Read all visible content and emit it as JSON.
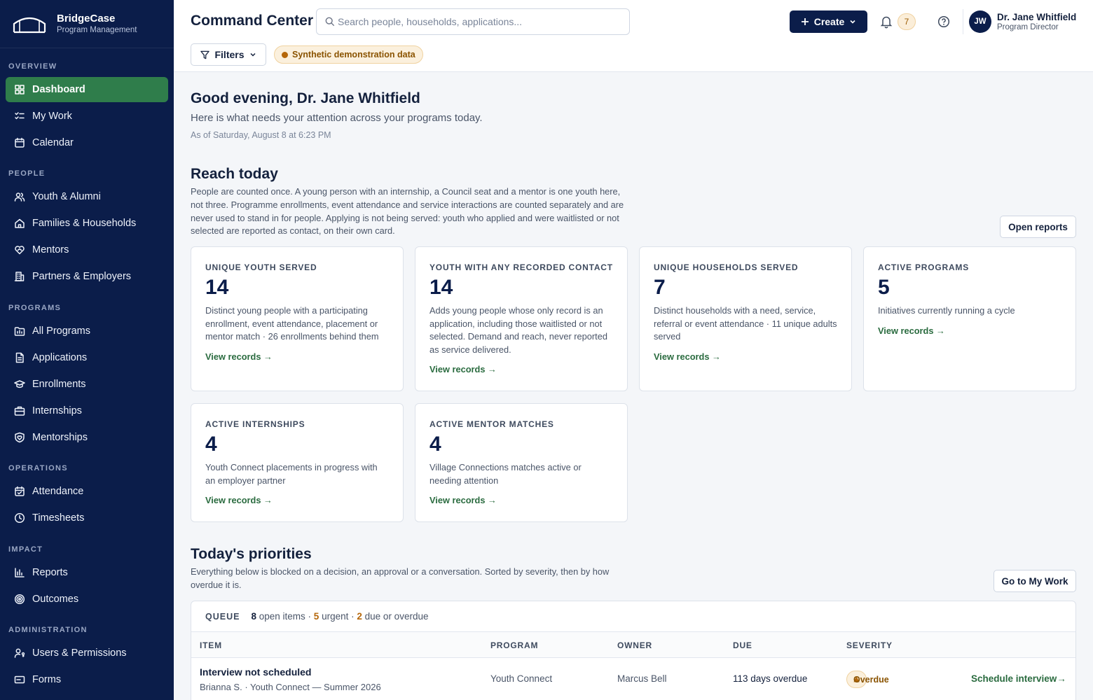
{
  "brand": {
    "name": "BridgeCase",
    "subtitle": "Program Management"
  },
  "sidebar": {
    "sections": [
      {
        "label": "OVERVIEW",
        "items": [
          {
            "label": "Dashboard",
            "icon": "dashboard-icon",
            "active": true
          },
          {
            "label": "My Work",
            "icon": "checklist-icon"
          },
          {
            "label": "Calendar",
            "icon": "calendar-icon"
          }
        ]
      },
      {
        "label": "PEOPLE",
        "items": [
          {
            "label": "Youth & Alumni",
            "icon": "users-icon"
          },
          {
            "label": "Families & Households",
            "icon": "home-icon"
          },
          {
            "label": "Mentors",
            "icon": "handshake-heart-icon"
          },
          {
            "label": "Partners & Employers",
            "icon": "building-icon"
          }
        ]
      },
      {
        "label": "PROGRAMS",
        "items": [
          {
            "label": "All Programs",
            "icon": "folder-icon"
          },
          {
            "label": "Applications",
            "icon": "document-icon"
          },
          {
            "label": "Enrollments",
            "icon": "graduation-cap-icon"
          },
          {
            "label": "Internships",
            "icon": "briefcase-icon"
          },
          {
            "label": "Mentorships",
            "icon": "shield-heart-icon"
          }
        ]
      },
      {
        "label": "OPERATIONS",
        "items": [
          {
            "label": "Attendance",
            "icon": "calendar-check-icon"
          },
          {
            "label": "Timesheets",
            "icon": "clock-icon"
          }
        ]
      },
      {
        "label": "IMPACT",
        "items": [
          {
            "label": "Reports",
            "icon": "bar-chart-icon"
          },
          {
            "label": "Outcomes",
            "icon": "target-icon"
          }
        ]
      },
      {
        "label": "ADMINISTRATION",
        "items": [
          {
            "label": "Users & Permissions",
            "icon": "user-key-icon"
          },
          {
            "label": "Forms",
            "icon": "form-icon"
          }
        ]
      }
    ]
  },
  "header": {
    "title": "Command Center",
    "search_placeholder": "Search people, households, applications...",
    "create_label": "Create",
    "notification_count": "7",
    "user_initials": "JW",
    "user_name": "Dr. Jane Whitfield",
    "user_role": "Program Director",
    "filters_label": "Filters",
    "demo_badge": "Synthetic demonstration data"
  },
  "greeting": {
    "title": "Good evening, Dr. Jane Whitfield",
    "subtitle": "Here is what needs your attention across your programs today.",
    "as_of": "As of Saturday, August 8 at 6:23 PM"
  },
  "reach": {
    "title": "Reach today",
    "description": "People are counted once. A young person with an internship, a Council seat and a mentor is one youth here, not three. Programme enrollments, event attendance and service interactions are counted separately and are never used to stand in for people. Applying is not being served: youth who applied and were waitlisted or not selected are reported as contact, on their own card.",
    "open_reports_label": "Open reports",
    "cards": [
      {
        "label": "UNIQUE YOUTH SERVED",
        "value": "14",
        "description": "Distinct young people with a participating enrollment, event attendance, placement or mentor match · 26 enrollments behind them",
        "link": "View records →"
      },
      {
        "label": "YOUTH WITH ANY RECORDED CONTACT",
        "value": "14",
        "description": "Adds young people whose only record is an application, including those waitlisted or not selected. Demand and reach, never reported as service delivered.",
        "link": "View records →"
      },
      {
        "label": "UNIQUE HOUSEHOLDS SERVED",
        "value": "7",
        "description": "Distinct households with a need, service, referral or event attendance · 11 unique adults served",
        "link": "View records →"
      },
      {
        "label": "ACTIVE PROGRAMS",
        "value": "5",
        "description": "Initiatives currently running a cycle",
        "link": "View records →"
      },
      {
        "label": "ACTIVE INTERNSHIPS",
        "value": "4",
        "description": "Youth Connect placements in progress with an employer partner",
        "link": "View records →"
      },
      {
        "label": "ACTIVE MENTOR MATCHES",
        "value": "4",
        "description": "Village Connections matches active or needing attention",
        "link": "View records →"
      }
    ]
  },
  "priorities": {
    "title": "Today's priorities",
    "description": "Everything below is blocked on a decision, an approval or a conversation. Sorted by severity, then by how overdue it is.",
    "go_label": "Go to My Work",
    "queue_label": "QUEUE",
    "open_count": "8",
    "open_text": "open items ·",
    "urgent_count": "5",
    "urgent_text": "urgent ·",
    "due_count": "2",
    "due_text": "due or overdue",
    "columns": [
      "ITEM",
      "PROGRAM",
      "OWNER",
      "DUE",
      "SEVERITY"
    ],
    "rows": [
      {
        "title": "Interview not scheduled",
        "subtitle": "Brianna S. · Youth Connect — Summer 2026",
        "program": "Youth Connect",
        "owner": "Marcus Bell",
        "due": "113 days overdue",
        "severity": "Overdue",
        "action": "Schedule interview→"
      }
    ]
  },
  "colors": {
    "sidebar_bg": "#0b1d4a",
    "active_nav": "#2f7d4b",
    "link_green": "#2a6b3f",
    "warning_bg": "#fbf0dd",
    "warning_text": "#8a5300"
  }
}
